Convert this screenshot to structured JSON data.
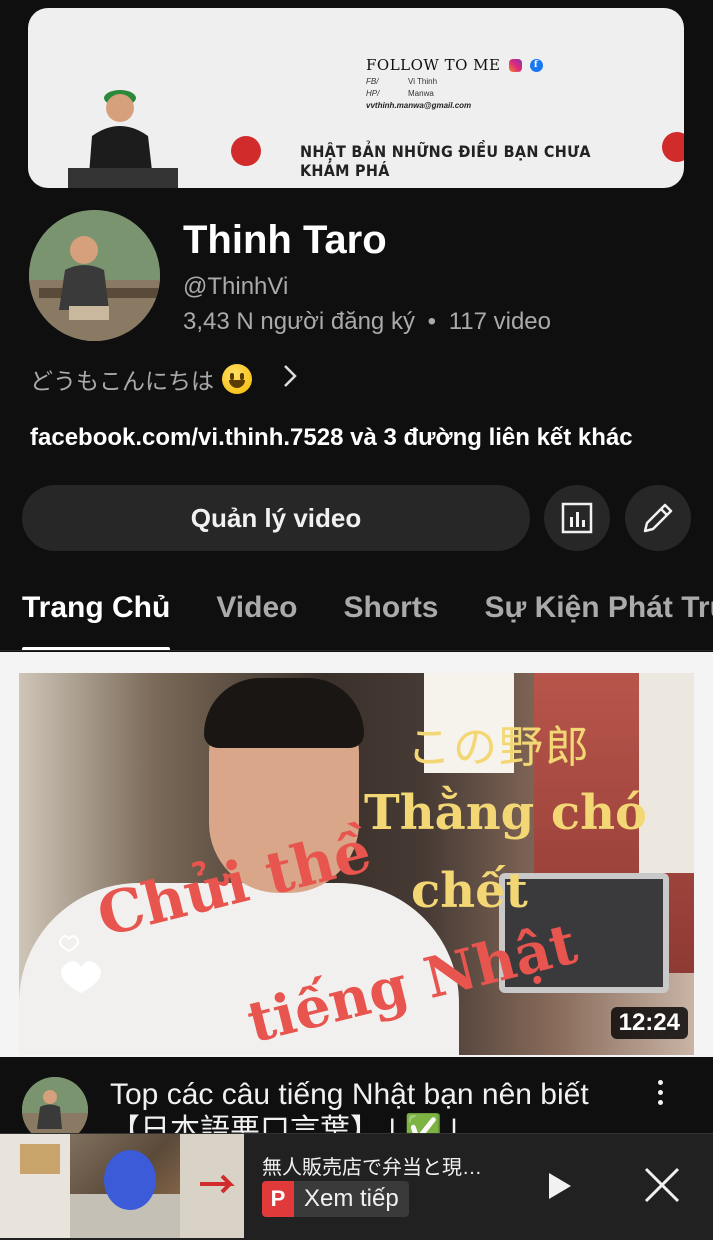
{
  "banner": {
    "follow_text": "FOLLOW TO ME",
    "fb_label": "FB/",
    "fb_value": "Vi Thinh",
    "hp_label": "HP/",
    "hp_value": "Manwa",
    "email": "vvthinh.manwa@gmail.com",
    "slogan": "NHẬT BẢN NHỮNG ĐIỀU BẠN CHƯA KHÁM PHÁ"
  },
  "channel": {
    "name": "Thinh Taro",
    "handle": "@ThinhVi",
    "subscribers": "3,43 N người đăng ký",
    "separator": "•",
    "video_count": "117 video",
    "description": "どうもこんにちは",
    "links": "facebook.com/vi.thinh.7528 và 3 đường liên kết khác"
  },
  "actions": {
    "manage_label": "Quản lý video",
    "stats_icon": "bar-chart-icon",
    "edit_icon": "pencil-icon"
  },
  "tabs": [
    {
      "label": "Trang Chủ",
      "active": true
    },
    {
      "label": "Video",
      "active": false
    },
    {
      "label": "Shorts",
      "active": false
    },
    {
      "label": "Sự Kiện Phát Trực Tiếp",
      "active": false
    }
  ],
  "featured": {
    "overlay_jp": "この野郎",
    "overlay_thang": "Thằng chó",
    "overlay_chet": "chết",
    "overlay_chui": "Chửi thề",
    "overlay_tieng": "tiếng Nhật",
    "duration": "12:24",
    "title": "Top các câu  tiếng Nhật bạn nên biết【日本語悪口言葉】 | ✅ |"
  },
  "mini_player": {
    "title": "無人販売店で弁当と現…",
    "badge_letter": "P",
    "badge_text": "Xem tiếp"
  },
  "colors": {
    "background": "#0f0f0f",
    "button_bg": "#272727",
    "secondary_text": "#aaaaaa",
    "accent_red": "#d22b2b"
  }
}
